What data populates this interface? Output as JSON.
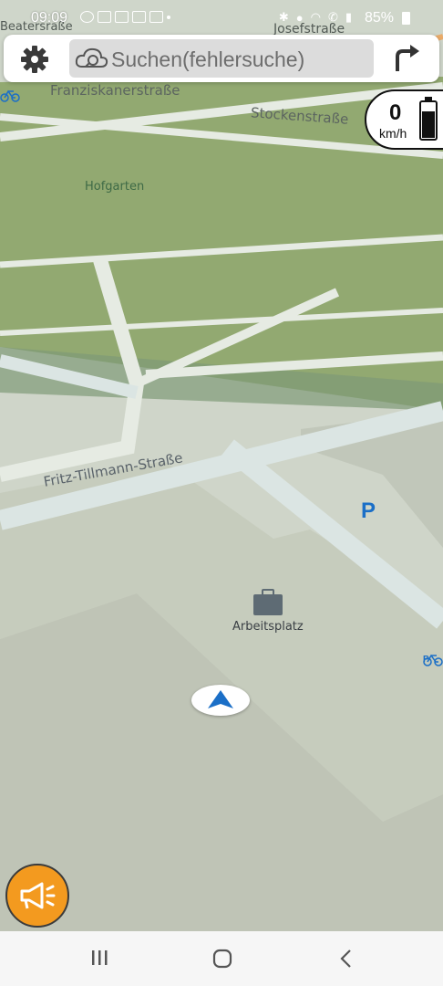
{
  "status_bar": {
    "time": "09:09",
    "battery": "85%",
    "notification_icons": [
      "whatsapp-icon",
      "mail-icon",
      "gallery-icon",
      "ntv-icon",
      "mail-icon",
      "dot-icon"
    ],
    "system_icons": [
      "bluetooth-icon",
      "location-icon",
      "wifi-icon",
      "call-icon",
      "signal-icon",
      "battery-icon"
    ]
  },
  "top_bar": {
    "settings_icon": "gear-icon",
    "search_placeholder": "Suchen(fehlersuche)",
    "search_icon": "cloud-search-icon",
    "route_icon": "turn-right-icon"
  },
  "speed_display": {
    "value": "0",
    "unit": "km/h"
  },
  "map": {
    "streets": [
      {
        "name": "Franziskanerstraße"
      },
      {
        "name": "Stockenstraße"
      },
      {
        "name": "Fritz-Tillmann-Straße"
      },
      {
        "name": "Josefstraße"
      },
      {
        "name": "Beatersraße"
      }
    ],
    "places": [
      {
        "name": "Hofgarten"
      },
      {
        "name": "Arbeitsplatz",
        "icon": "briefcase-icon"
      }
    ],
    "parking_label": "P",
    "bike_label": "P",
    "colors": {
      "park": "#8aa66a",
      "road": "#dbe5e3",
      "building": "#c8ccbf",
      "accent": "#1b6fc7"
    }
  },
  "speaker_button": {
    "icon": "megaphone-icon",
    "color": "#f39a1f"
  },
  "nav_bar": {
    "recent_icon": "recent-apps-icon",
    "home_icon": "home-icon",
    "back_icon": "back-icon"
  }
}
